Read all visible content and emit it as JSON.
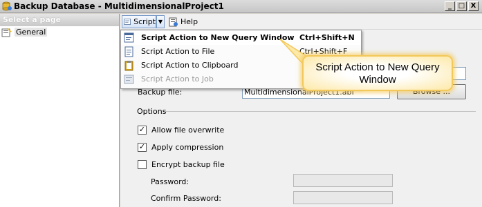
{
  "window": {
    "title": "Backup Database - MultidimensionalProject1",
    "minimize": "_",
    "maximize": "□",
    "close": "X"
  },
  "left_pane": {
    "header": "Select a page",
    "items": [
      {
        "label": "General",
        "icon": "page-icon"
      }
    ]
  },
  "toolbar": {
    "script_label": "Script",
    "dropdown_glyph": "▼",
    "help_label": "Help"
  },
  "menu": {
    "items": [
      {
        "label": "Script Action to New Query Window",
        "shortcut": "Ctrl+Shift+N",
        "icon": "new-query-icon",
        "state": "selected"
      },
      {
        "label": "Script Action to File",
        "shortcut": "Ctrl+Shift+F",
        "icon": "file-icon",
        "state": "normal"
      },
      {
        "label": "Script Action to Clipboard",
        "shortcut": "",
        "icon": "clipboard-icon",
        "state": "normal"
      },
      {
        "label": "Script Action to Job",
        "shortcut": "",
        "icon": "job-icon",
        "state": "disabled"
      }
    ]
  },
  "form": {
    "backup_file_label": "Backup file:",
    "backup_file_value": "MultidimensionalProject1.abf",
    "browse_label": "Browse ...",
    "options_label": "Options",
    "allow_overwrite_label": "Allow file overwrite",
    "allow_overwrite_checked": true,
    "apply_compression_label": "Apply compression",
    "apply_compression_checked": true,
    "encrypt_label": "Encrypt backup file",
    "encrypt_checked": false,
    "password_label": "Password:",
    "confirm_password_label": "Confirm Password:",
    "check_glyph": "✓"
  },
  "callout": {
    "text": "Script Action to New Query Window"
  },
  "colors": {
    "callout_border": "#f3c85a",
    "menu_border": "#979797",
    "selected_item_bg": "#ffffff"
  }
}
